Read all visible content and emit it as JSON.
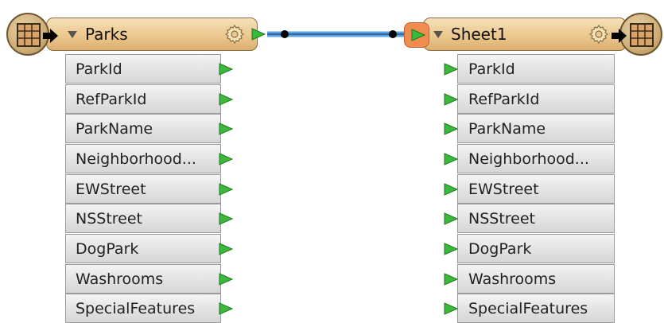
{
  "reader": {
    "title": "Parks",
    "badge_icon": "table-icon",
    "settings_icon": "gear-icon",
    "attributes": [
      "ParkId",
      "RefParkId",
      "ParkName",
      "Neighborhood...",
      "EWStreet",
      "NSStreet",
      "DogPark",
      "Washrooms",
      "SpecialFeatures"
    ]
  },
  "writer": {
    "title": "Sheet1",
    "badge_icon": "table-icon",
    "settings_icon": "gear-icon",
    "attributes": [
      "ParkId",
      "RefParkId",
      "ParkName",
      "Neighborhood...",
      "EWStreet",
      "NSStreet",
      "DogPark",
      "Washrooms",
      "SpecialFeatures"
    ]
  },
  "colors": {
    "header": "#ecc88e",
    "attribute_row": "#e4e4e4",
    "port_green": "#3cb83c",
    "connection": "#5aa2e6",
    "port_selected": "#f08c50"
  }
}
